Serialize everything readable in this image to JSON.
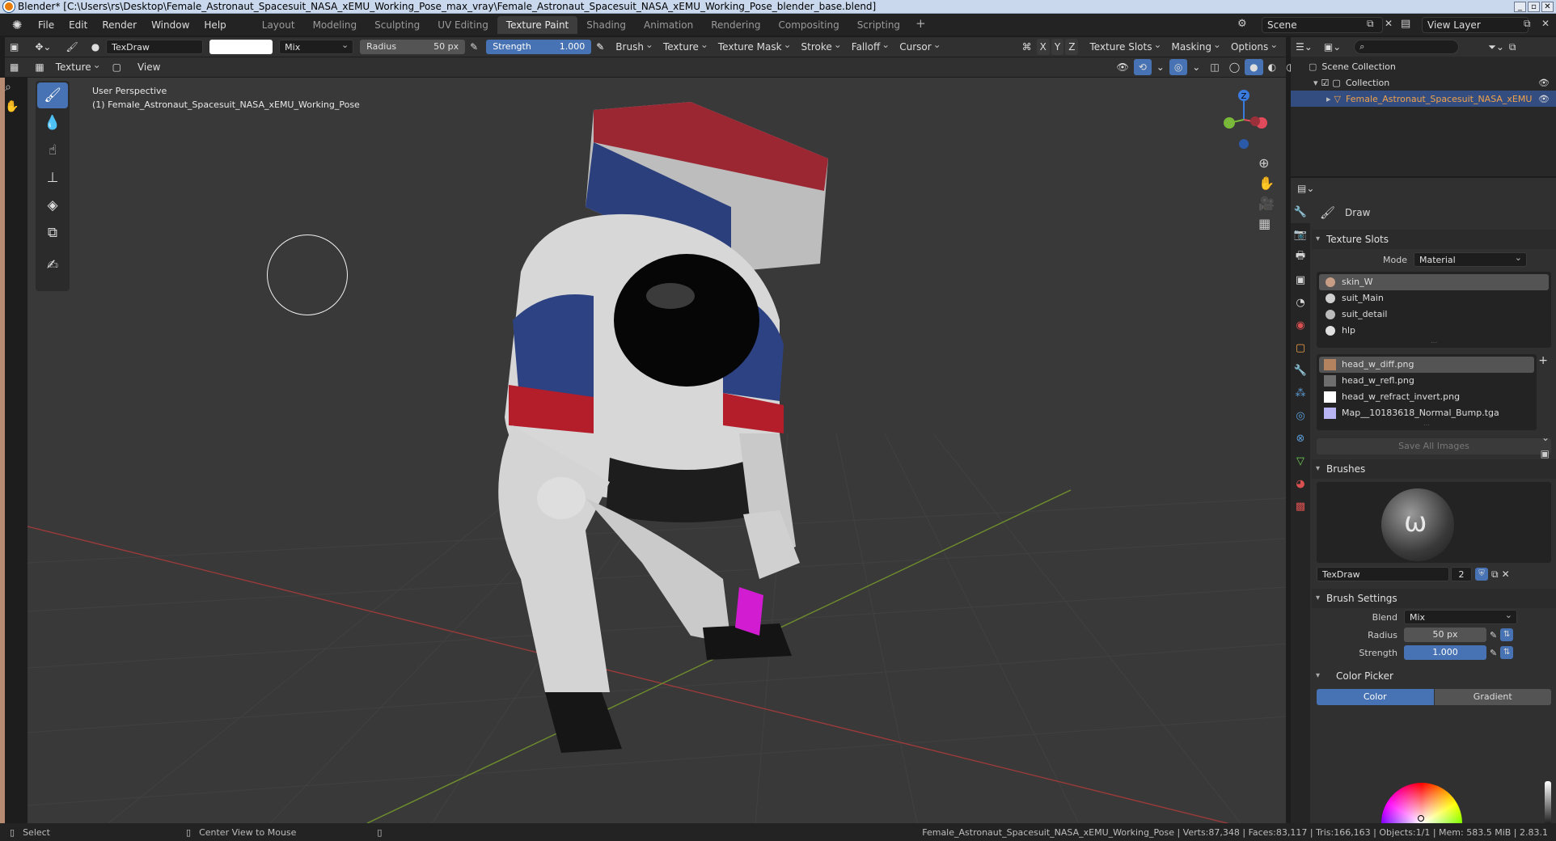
{
  "window": {
    "title": "Blender* [C:\\Users\\rs\\Desktop\\Female_Astronaut_Spacesuit_NASA_xEMU_Working_Pose_max_vray\\Female_Astronaut_Spacesuit_NASA_xEMU_Working_Pose_blender_base.blend]"
  },
  "menu": [
    "File",
    "Edit",
    "Render",
    "Window",
    "Help"
  ],
  "workspaces": [
    "Layout",
    "Modeling",
    "Sculpting",
    "UV Editing",
    "Texture Paint",
    "Shading",
    "Animation",
    "Rendering",
    "Compositing",
    "Scripting"
  ],
  "active_workspace": "Texture Paint",
  "scene": {
    "name": "Scene",
    "view_layer": "View Layer"
  },
  "tool_header": {
    "brush_name": "TexDraw",
    "blend": "Mix",
    "radius_label": "Radius",
    "radius_value": "50 px",
    "strength_label": "Strength",
    "strength_value": "1.000",
    "brush": "Brush",
    "texture": "Texture",
    "texture_mask": "Texture Mask",
    "stroke": "Stroke",
    "falloff": "Falloff",
    "cursor": "Cursor",
    "axes": [
      "X",
      "Y",
      "Z"
    ],
    "texture_slots": "Texture Slots",
    "masking": "Masking",
    "options": "Options"
  },
  "mode_header": {
    "mode": "Texture Paint",
    "view": "View"
  },
  "viewport": {
    "perspective": "User Perspective",
    "object_label": "(1) Female_Astronaut_Spacesuit_NASA_xEMU_Working_Pose",
    "gizmo_axis_z": "Z"
  },
  "outliner": {
    "scene_collection": "Scene Collection",
    "collection": "Collection",
    "object": "Female_Astronaut_Spacesuit_NASA_xEMU_W"
  },
  "properties": {
    "tool_name": "Draw",
    "texture_slots_title": "Texture Slots",
    "mode_label": "Mode",
    "mode_value": "Material",
    "materials": [
      {
        "name": "skin_W",
        "color": "#c89d86"
      },
      {
        "name": "suit_Main",
        "color": "#cfcfcf"
      },
      {
        "name": "suit_detail",
        "color": "#bcbcbc"
      },
      {
        "name": "hlp",
        "color": "#e0e0e0"
      }
    ],
    "images": [
      {
        "name": "head_w_diff.png",
        "color": "#b3835f"
      },
      {
        "name": "head_w_refl.png",
        "color": "#6e6e6e"
      },
      {
        "name": "head_w_refract_invert.png",
        "color": "#ffffff"
      },
      {
        "name": "Map__10183618_Normal_Bump.tga",
        "color": "#b9b5f5"
      }
    ],
    "save_all_images": "Save All Images",
    "brushes_title": "Brushes",
    "brush_datablock": "TexDraw",
    "brush_users": "2",
    "brush_settings_title": "Brush Settings",
    "blend_label": "Blend",
    "blend_value": "Mix",
    "radius_label": "Radius",
    "radius_value": "50 px",
    "strength_label": "Strength",
    "strength_value": "1.000",
    "color_picker_title": "Color Picker",
    "color_tab": "Color",
    "gradient_tab": "Gradient"
  },
  "statusbar": {
    "select": "Select",
    "center_view": "Center View to Mouse",
    "stats": "Female_Astronaut_Spacesuit_NASA_xEMU_Working_Pose | Verts:87,348 | Faces:83,117 | Tris:166,163 | Objects:1/1 | Mem: 583.5 MiB | 2.83.1"
  },
  "colors": {
    "accent": "#4772b3",
    "selection": "#334d80",
    "viewport_bg": "#393939"
  }
}
